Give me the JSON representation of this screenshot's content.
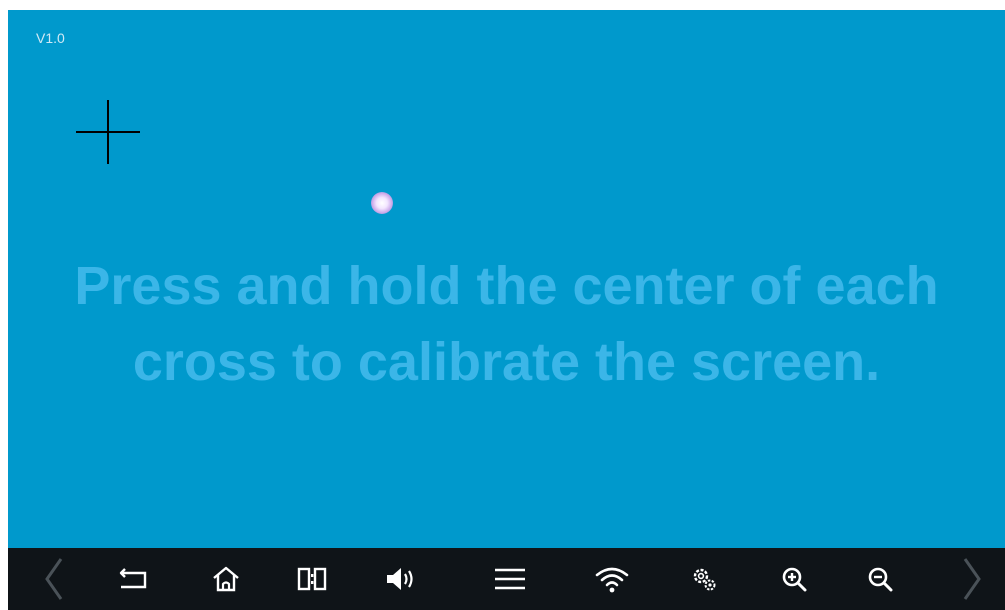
{
  "version": "V1.0",
  "instruction": {
    "line1": "Press and hold the center of each",
    "line2": "cross to calibrate the screen."
  },
  "navbar": {
    "buttons": [
      {
        "icon": "chevron-left-icon"
      },
      {
        "icon": "back-icon"
      },
      {
        "icon": "home-icon"
      },
      {
        "icon": "recent-apps-icon"
      },
      {
        "icon": "volume-icon"
      },
      {
        "icon": "menu-icon"
      },
      {
        "icon": "wifi-icon"
      },
      {
        "icon": "settings-icon"
      },
      {
        "icon": "zoom-in-icon"
      },
      {
        "icon": "zoom-out-icon"
      },
      {
        "icon": "chevron-right-icon"
      }
    ]
  },
  "colors": {
    "background": "#0099cc",
    "instruction_text": "#3bb6e8",
    "navbar": "#0f1418",
    "icon": "#ffffff",
    "disabled_icon": "#4a5258"
  }
}
